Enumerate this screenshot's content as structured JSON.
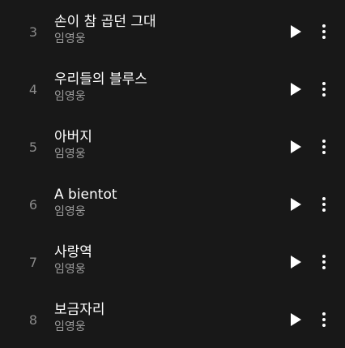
{
  "tracks": [
    {
      "number": "3",
      "title": "손이 참 곱던 그대",
      "artist": "임영웅"
    },
    {
      "number": "4",
      "title": "우리들의 블루스",
      "artist": "임영웅"
    },
    {
      "number": "5",
      "title": "아버지",
      "artist": "임영웅"
    },
    {
      "number": "6",
      "title": "A bientot",
      "artist": "임영웅"
    },
    {
      "number": "7",
      "title": "사랑역",
      "artist": "임영웅"
    },
    {
      "number": "8",
      "title": "보금자리",
      "artist": "임영웅"
    }
  ],
  "icons": {
    "play": "play-icon",
    "more": "more-vertical-icon"
  },
  "colors": {
    "background": "#181818",
    "title": "#ffffff",
    "secondary": "#9a9a9a",
    "number": "#8a8a8a"
  }
}
